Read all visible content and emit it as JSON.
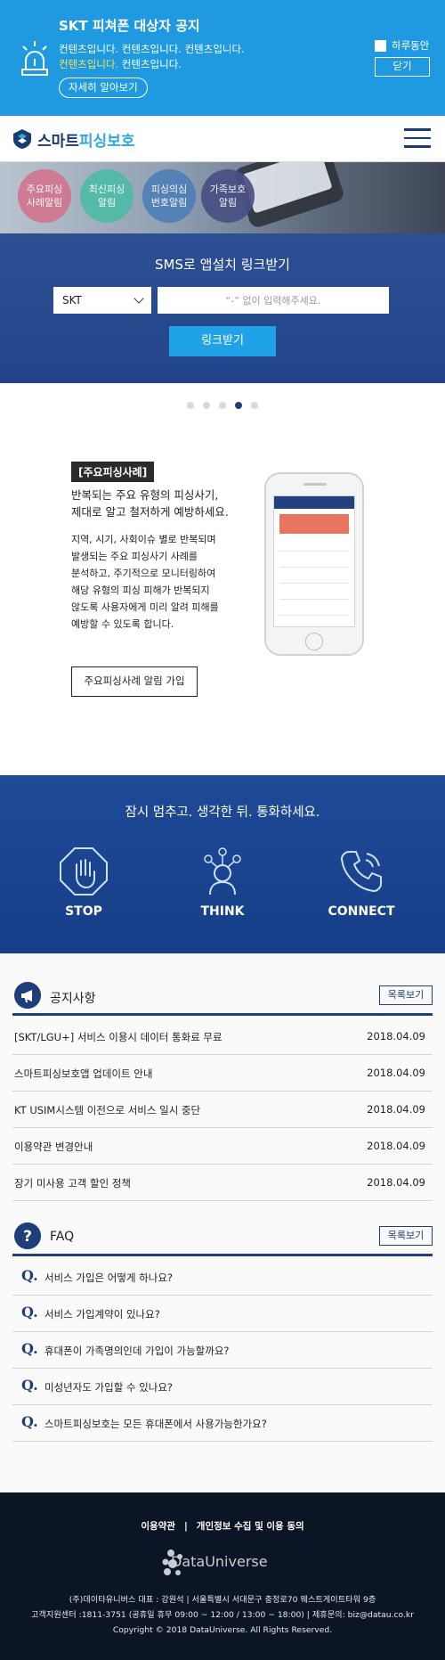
{
  "alert": {
    "title": "SKT 피쳐폰 대상자 공지",
    "line1": "컨텐츠입니다. 컨텐츠입니다. 컨텐츠입니다.",
    "line2_highlight": "컨텐츠입니다.",
    "line2_rest": " 컨텐츠입니다.",
    "more_label": "자세히 알아보기",
    "today_label": "하루동안",
    "close_label": "닫기"
  },
  "header": {
    "logo_main": "스마트",
    "logo_accent": "피싱보호",
    "menu_icon": "hamburger-icon"
  },
  "quick_menu": [
    {
      "label": "주요피싱\n사례알림",
      "color": "#d1768f"
    },
    {
      "label": "최신피싱\n알림",
      "color": "#4fbba7"
    },
    {
      "label": "피싱의심\n번호알림",
      "color": "#4f7fb7"
    },
    {
      "label": "가족보호\n알림",
      "color": "#4b4f84"
    }
  ],
  "sms": {
    "title": "SMS로 앱설치 링크받기",
    "carrier": "SKT",
    "phone_placeholder": "“-” 없이 입력해주세요.",
    "button": "링크받기"
  },
  "carousel": {
    "active_index": 3,
    "dot_count": 5,
    "tag": "[주요피싱사례]",
    "heading": "반복되는 주요 유형의 피싱사기,\n제대로 알고 철저하게 예방하세요.",
    "body": "지역, 시기, 사회이슈 별로 반복되며\n발생되는 주요 피싱사기 사례를\n분석하고, 주기적으로 모니터링하여\n해당 유형의 피싱 피해가 반복되지\n않도록 사용자에게 미리 알려 피해를\n예방할 수 있도록 합니다.",
    "button": "주요피싱사례 알림 가입"
  },
  "campaign": {
    "title": "잠시 멈추고. 생각한 뒤. 통화하세요.",
    "items": [
      {
        "label": "STOP",
        "icon": "stop-hand-icon"
      },
      {
        "label": "THINK",
        "icon": "think-person-icon"
      },
      {
        "label": "CONNECT",
        "icon": "phone-icon"
      }
    ]
  },
  "notice": {
    "title": "공지사항",
    "more": "목록보기",
    "icon": "megaphone-icon",
    "items": [
      {
        "title": "[SKT/LGU+] 서비스 이용시 데이터 통화료 무료",
        "date": "2018.04.09"
      },
      {
        "title": "스마트피싱보호앱 업데이트 안내",
        "date": "2018.04.09"
      },
      {
        "title": "KT USIM시스템 이전으로 서비스 일시 중단",
        "date": "2018.04.09"
      },
      {
        "title": "이용약관 변경안내",
        "date": "2018.04.09"
      },
      {
        "title": "장기 미사용 고객 할인 정책",
        "date": "2018.04.09"
      }
    ]
  },
  "faq": {
    "title": "FAQ",
    "more": "목록보기",
    "icon": "question-icon",
    "q_mark": "Q.",
    "items": [
      "서비스 가입은 어떻게 하나요?",
      "서비스 가입계약이 있나요?",
      "휴대폰이 가족명의인데 가입이 가능할까요?",
      "미성년자도 가입할 수 있나요?",
      "스마트피싱보호는 모든 휴대폰에서 사용가능한가요?"
    ]
  },
  "footer": {
    "link1": "이용약관",
    "sep": "|",
    "link2": "개인정보 수집 및 이용 동의",
    "brand": "DataUniverse",
    "line1": "(주)데이타유니버스 대표 : 강원석 | 서울특별시 서대문구 충정로70 웨스트게이트타워 9층",
    "line2": "고객지원센터 :1811-3751 (공휴일 휴무 09:00 ~ 12:00 / 13:00 ~ 18:00) | 제휴문의: biz@datau.co.kr",
    "line3": "Copyright © 2018 DataUniverse. All Rights Reserved."
  },
  "colors": {
    "alert_bg": "#1f9ae0",
    "primary_navy": "#1f3f7a",
    "accent_blue": "#1fa3e6",
    "footer_bg": "#0c1526"
  }
}
